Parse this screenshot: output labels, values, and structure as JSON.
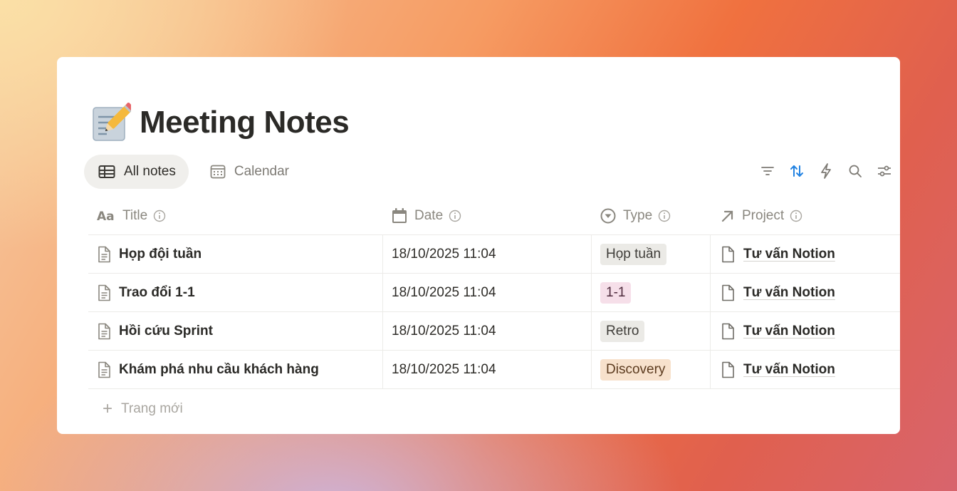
{
  "page": {
    "title": "Meeting Notes",
    "emoji": "memo-pencil"
  },
  "views": [
    {
      "label": "All notes",
      "icon": "table-icon",
      "active": true
    },
    {
      "label": "Calendar",
      "icon": "calendar-icon",
      "active": false
    }
  ],
  "toolbar": {
    "icons": [
      "filter-icon",
      "sort-icon",
      "automation-icon",
      "search-icon",
      "settings-icon"
    ],
    "sort_color": "#2383e2"
  },
  "columns": [
    {
      "label": "Title",
      "icon": "text-property-icon"
    },
    {
      "label": "Date",
      "icon": "date-property-icon"
    },
    {
      "label": "Type",
      "icon": "select-property-icon"
    },
    {
      "label": "Project",
      "icon": "relation-property-icon"
    }
  ],
  "rows": [
    {
      "title": "Họp đội tuần",
      "date": "18/10/2025 11:04",
      "type": "Họp tuần",
      "type_bg": "#ebeae6",
      "type_fg": "#3f3d39",
      "project": "Tư vấn Notion"
    },
    {
      "title": "Trao đổi 1-1",
      "date": "18/10/2025 11:04",
      "type": "1-1",
      "type_bg": "#f6dfe9",
      "type_fg": "#4e2a3c",
      "project": "Tư vấn Notion"
    },
    {
      "title": "Hồi cứu Sprint",
      "date": "18/10/2025 11:04",
      "type": "Retro",
      "type_bg": "#ebeae6",
      "type_fg": "#3f3d39",
      "project": "Tư vấn Notion"
    },
    {
      "title": "Khám phá nhu cầu khách hàng",
      "date": "18/10/2025 11:04",
      "type": "Discovery",
      "type_bg": "#f7e1cc",
      "type_fg": "#5c3b1f",
      "project": "Tư vấn Notion"
    }
  ],
  "new_page": {
    "label": "Trang mới"
  }
}
